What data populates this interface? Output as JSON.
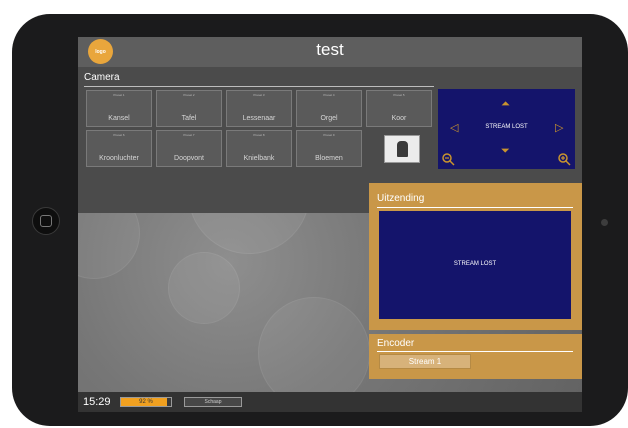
{
  "app": {
    "title": "test",
    "logo_text": "logo"
  },
  "camera": {
    "label": "Camera",
    "presets": [
      {
        "number": "Preset 1",
        "label": "Kansel"
      },
      {
        "number": "Preset 2",
        "label": "Tafel"
      },
      {
        "number": "Preset 3",
        "label": "Lessenaar"
      },
      {
        "number": "Preset 4",
        "label": "Orgel"
      },
      {
        "number": "Preset 5",
        "label": "Koor"
      },
      {
        "number": "Preset 6",
        "label": "Kroonluchter"
      },
      {
        "number": "Preset 7",
        "label": "Doopvont"
      },
      {
        "number": "Preset 8",
        "label": "Knielbank"
      },
      {
        "number": "Preset 9",
        "label": "Bloemen"
      }
    ],
    "stream_status": "STREAM LOST",
    "controls": [
      "arrow-up-icon",
      "arrow-down-icon",
      "arrow-left-icon",
      "arrow-right-icon",
      "zoom-out-icon",
      "zoom-in-icon"
    ]
  },
  "broadcast": {
    "label": "Uitzending",
    "stream_status": "STREAM LOST"
  },
  "encoder": {
    "label": "Encoder",
    "button_label": "Stream 1"
  },
  "status": {
    "time": "15:29",
    "battery_text": "92 %",
    "battery_percent": 92,
    "button_label": "Schaap"
  },
  "colors": {
    "accent": "#c99748",
    "stream_bg": "#14146b",
    "progress": "#f0a020"
  }
}
